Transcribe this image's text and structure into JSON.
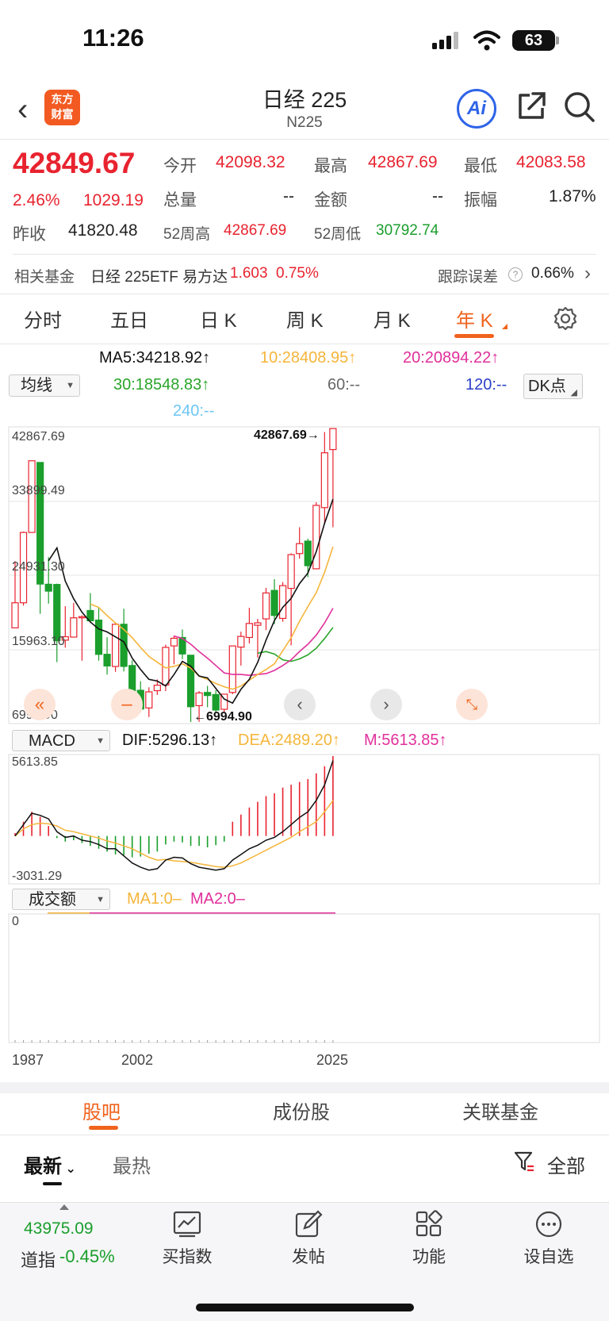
{
  "status": {
    "time": "11:26",
    "battery": "63"
  },
  "header": {
    "logo_line1": "东方",
    "logo_line2": "财富",
    "title": "日经 225",
    "subtitle": "N225",
    "ai_label": "Ai"
  },
  "quote": {
    "price": "42849.67",
    "change_pct": "2.46%",
    "change": "1029.19",
    "prev_close_label": "昨收",
    "prev_close": "41820.48",
    "open_label": "今开",
    "open": "42098.32",
    "high_label": "最高",
    "high": "42867.69",
    "low_label": "最低",
    "low": "42083.58",
    "volume_label": "总量",
    "volume": "--",
    "amount_label": "金额",
    "amount": "--",
    "amplitude_label": "振幅",
    "amplitude": "1.87%",
    "w52_high_label": "52周高",
    "w52_high": "42867.69",
    "w52_low_label": "52周低",
    "w52_low": "30792.74"
  },
  "fund": {
    "label": "相关基金",
    "name": "日经 225ETF 易方达",
    "price": "1.603",
    "pct": "0.75%",
    "error_label": "跟踪误差",
    "error": "0.66%"
  },
  "tabs": [
    "分时",
    "五日",
    "日 K",
    "周 K",
    "月 K",
    "年 K"
  ],
  "active_tab": "年 K",
  "ma": {
    "ma5": "MA5:34218.92↑",
    "ma10": "10:28408.95↑",
    "ma20": "20:20894.22↑",
    "ma30": "30:18548.83↑",
    "ma60": "60:--",
    "ma120": "120:--",
    "ma240": "240:--",
    "select": "均线",
    "dk": "DK点"
  },
  "kline": {
    "yticks": [
      "42867.69",
      "33899.49",
      "24931.30",
      "15963.10",
      "6994.90"
    ],
    "max_label": "42867.69",
    "min_label": "6994.90"
  },
  "macd": {
    "select": "MACD",
    "dif": "DIF:5296.13↑",
    "dea": "DEA:2489.20↑",
    "m": "M:5613.85↑",
    "top": "5613.85",
    "bottom": "-3031.29"
  },
  "volume_panel": {
    "select": "成交额",
    "ma1": "MA1:0–",
    "ma2": "MA2:0–",
    "zero": "0"
  },
  "xaxis": [
    "1987",
    "2002",
    "2025"
  ],
  "bottom_tabs": [
    "股吧",
    "成份股",
    "关联基金"
  ],
  "filters": {
    "latest": "最新",
    "hot": "最热",
    "all": "全部"
  },
  "ticker": {
    "price": "43975.09",
    "name": "道指",
    "pct": "-0.45%"
  },
  "tools": [
    "买指数",
    "发帖",
    "功能",
    "设自选"
  ],
  "colors": {
    "up": "#e8232f",
    "down": "#1a9e2c",
    "accent": "#f0631c",
    "ma5": "#111111",
    "ma10": "#f5b53a",
    "ma20": "#e0309b",
    "ma30": "#2aa52a",
    "ma120": "#2b3fc7",
    "ma240": "#6cc6f5"
  },
  "chart_data": [
    {
      "type": "candlestick",
      "title": "",
      "xlabel": "",
      "ylabel": "",
      "ylim": [
        6994.9,
        42867.69
      ],
      "x": [
        1987,
        1988,
        1989,
        1990,
        1991,
        1992,
        1993,
        1994,
        1995,
        1996,
        1997,
        1998,
        1999,
        2000,
        2001,
        2002,
        2003,
        2004,
        2005,
        2006,
        2007,
        2008,
        2009,
        2010,
        2011,
        2012,
        2013,
        2014,
        2015,
        2016,
        2017,
        2018,
        2019,
        2020,
        2021,
        2022,
        2023,
        2024,
        2025
      ],
      "candles": [
        {
          "o": 18500,
          "c": 21564,
          "h": 26646,
          "l": 18500
        },
        {
          "o": 21564,
          "c": 30159,
          "h": 30264,
          "l": 21217
        },
        {
          "o": 30159,
          "c": 38916,
          "h": 38957,
          "l": 30183
        },
        {
          "o": 38712,
          "c": 23849,
          "h": 38712,
          "l": 20222
        },
        {
          "o": 23827,
          "c": 22984,
          "h": 27146,
          "l": 21457
        },
        {
          "o": 23801,
          "c": 16925,
          "h": 23901,
          "l": 14309
        },
        {
          "o": 16995,
          "c": 17417,
          "h": 21148,
          "l": 16078
        },
        {
          "o": 17370,
          "c": 19723,
          "h": 21552,
          "l": 17370
        },
        {
          "o": 19723,
          "c": 19868,
          "h": 20023,
          "l": 14485
        },
        {
          "o": 20618,
          "c": 19361,
          "h": 22750,
          "l": 19161
        },
        {
          "o": 19446,
          "c": 15259,
          "h": 20910,
          "l": 14488
        },
        {
          "o": 15268,
          "c": 13842,
          "h": 17352,
          "l": 12787
        },
        {
          "o": 13779,
          "c": 18934,
          "h": 19036,
          "l": 13122
        },
        {
          "o": 18937,
          "c": 13786,
          "h": 20833,
          "l": 13182
        },
        {
          "o": 13898,
          "c": 10543,
          "h": 14529,
          "l": 9382
        },
        {
          "o": 10871,
          "c": 8579,
          "h": 11980,
          "l": 8197
        },
        {
          "o": 8713,
          "c": 10677,
          "h": 11238,
          "l": 7607
        },
        {
          "o": 10825,
          "c": 11489,
          "h": 12195,
          "l": 10299
        },
        {
          "o": 11518,
          "c": 16111,
          "h": 16445,
          "l": 10770
        },
        {
          "o": 16294,
          "c": 17226,
          "h": 17563,
          "l": 14045
        },
        {
          "o": 17322,
          "c": 15308,
          "h": 18300,
          "l": 14669
        },
        {
          "o": 15155,
          "c": 8860,
          "h": 15156,
          "l": 6994.9
        },
        {
          "o": 8991,
          "c": 10546,
          "h": 10767,
          "l": 7021
        },
        {
          "o": 10609,
          "c": 10229,
          "h": 11408,
          "l": 8796
        },
        {
          "o": 10352,
          "c": 8455,
          "h": 10891,
          "l": 8135
        },
        {
          "o": 8549,
          "c": 10395,
          "h": 10433,
          "l": 8238
        },
        {
          "o": 10604,
          "c": 16291,
          "h": 16320,
          "l": 10398
        },
        {
          "o": 16147,
          "c": 17451,
          "h": 18030,
          "l": 13885
        },
        {
          "o": 17325,
          "c": 19034,
          "h": 20952,
          "l": 16592
        },
        {
          "o": 18818,
          "c": 19114,
          "h": 19592,
          "l": 14864
        },
        {
          "o": 19594,
          "c": 22765,
          "h": 23382,
          "l": 18225
        },
        {
          "o": 23074,
          "c": 20015,
          "h": 24448,
          "l": 18949
        },
        {
          "o": 19655,
          "c": 23657,
          "h": 24091,
          "l": 19241
        },
        {
          "o": 23319,
          "c": 27444,
          "h": 27602,
          "l": 16358
        },
        {
          "o": 27575,
          "c": 28792,
          "h": 30796,
          "l": 26954
        },
        {
          "o": 29098,
          "c": 26095,
          "h": 29388,
          "l": 24681
        },
        {
          "o": 25717,
          "c": 33464,
          "h": 33853,
          "l": 25662
        },
        {
          "o": 33193,
          "c": 39894,
          "h": 42427,
          "l": 31156
        },
        {
          "o": 40288,
          "c": 42849.67,
          "h": 42867.69,
          "l": 30792.74
        }
      ],
      "ma5": [
        null,
        null,
        null,
        null,
        26694,
        28264,
        24218,
        22048,
        20400,
        19200,
        18366,
        18000,
        17400,
        16800,
        14800,
        13400,
        12200,
        12000,
        11400,
        12800,
        14400,
        13800,
        12600,
        12400,
        11100,
        9800,
        9300,
        11000,
        12200,
        14300,
        17000,
        19400,
        21000,
        22100,
        23900,
        25200,
        27800,
        31300,
        34218.92
      ],
      "ma10": [
        null,
        null,
        null,
        null,
        null,
        null,
        null,
        null,
        null,
        21400,
        21000,
        20000,
        19100,
        18300,
        17300,
        16100,
        15000,
        14300,
        13600,
        13800,
        14100,
        13600,
        12600,
        12200,
        11700,
        11300,
        11000,
        11400,
        12100,
        12800,
        13400,
        14100,
        15700,
        17300,
        19300,
        21100,
        22800,
        25300,
        28408.95
      ],
      "ma20": [
        null,
        null,
        null,
        null,
        null,
        null,
        null,
        null,
        null,
        null,
        null,
        null,
        null,
        null,
        null,
        null,
        null,
        null,
        null,
        17500,
        17200,
        16500,
        15600,
        14800,
        13900,
        13000,
        12800,
        12800,
        12700,
        12800,
        12900,
        13300,
        13900,
        14600,
        15600,
        16500,
        17600,
        19100,
        20894.22
      ],
      "ma30": [
        null,
        null,
        null,
        null,
        null,
        null,
        null,
        null,
        null,
        null,
        null,
        null,
        null,
        null,
        null,
        null,
        null,
        null,
        null,
        null,
        null,
        null,
        null,
        null,
        null,
        null,
        null,
        null,
        null,
        15400,
        15600,
        15300,
        14600,
        14400,
        14700,
        15200,
        16000,
        17200,
        18548.83
      ]
    },
    {
      "type": "bar",
      "title": "MACD",
      "ylim": [
        -3031.29,
        5613.85
      ],
      "x": [
        1987,
        1988,
        1989,
        1990,
        1991,
        1992,
        1993,
        1994,
        1995,
        1996,
        1997,
        1998,
        1999,
        2000,
        2001,
        2002,
        2003,
        2004,
        2005,
        2006,
        2007,
        2008,
        2009,
        2010,
        2011,
        2012,
        2013,
        2014,
        2015,
        2016,
        2017,
        2018,
        2019,
        2020,
        2021,
        2022,
        2023,
        2024,
        2025
      ],
      "m": [
        200,
        1000,
        1700,
        1350,
        700,
        -150,
        -400,
        -300,
        -500,
        -700,
        -900,
        -1100,
        -1300,
        -1350,
        -1500,
        -1450,
        -1250,
        -1100,
        -600,
        -400,
        -450,
        -700,
        -700,
        -800,
        -650,
        -400,
        1000,
        1500,
        2000,
        2400,
        2800,
        3000,
        3400,
        3600,
        3800,
        4000,
        4400,
        4900,
        5613.85
      ],
      "dif": [
        0,
        800,
        1600,
        1450,
        1200,
        300,
        -100,
        0,
        -300,
        -400,
        -600,
        -900,
        -900,
        -1400,
        -1900,
        -2200,
        -2400,
        -2300,
        -1700,
        -1500,
        -1550,
        -1950,
        -2200,
        -2300,
        -2400,
        -2300,
        -1700,
        -1300,
        -900,
        -650,
        -300,
        -100,
        300,
        800,
        1300,
        1700,
        2500,
        3600,
        5296.13
      ],
      "dea": [
        0,
        500,
        800,
        900,
        850,
        700,
        400,
        300,
        150,
        0,
        -150,
        -350,
        -500,
        -700,
        -900,
        -1200,
        -1500,
        -1700,
        -1650,
        -1750,
        -1800,
        -1850,
        -1950,
        -2050,
        -2150,
        -2200,
        -2100,
        -1900,
        -1600,
        -1300,
        -1000,
        -700,
        -400,
        -100,
        300,
        650,
        1000,
        1700,
        2489.2
      ]
    }
  ]
}
